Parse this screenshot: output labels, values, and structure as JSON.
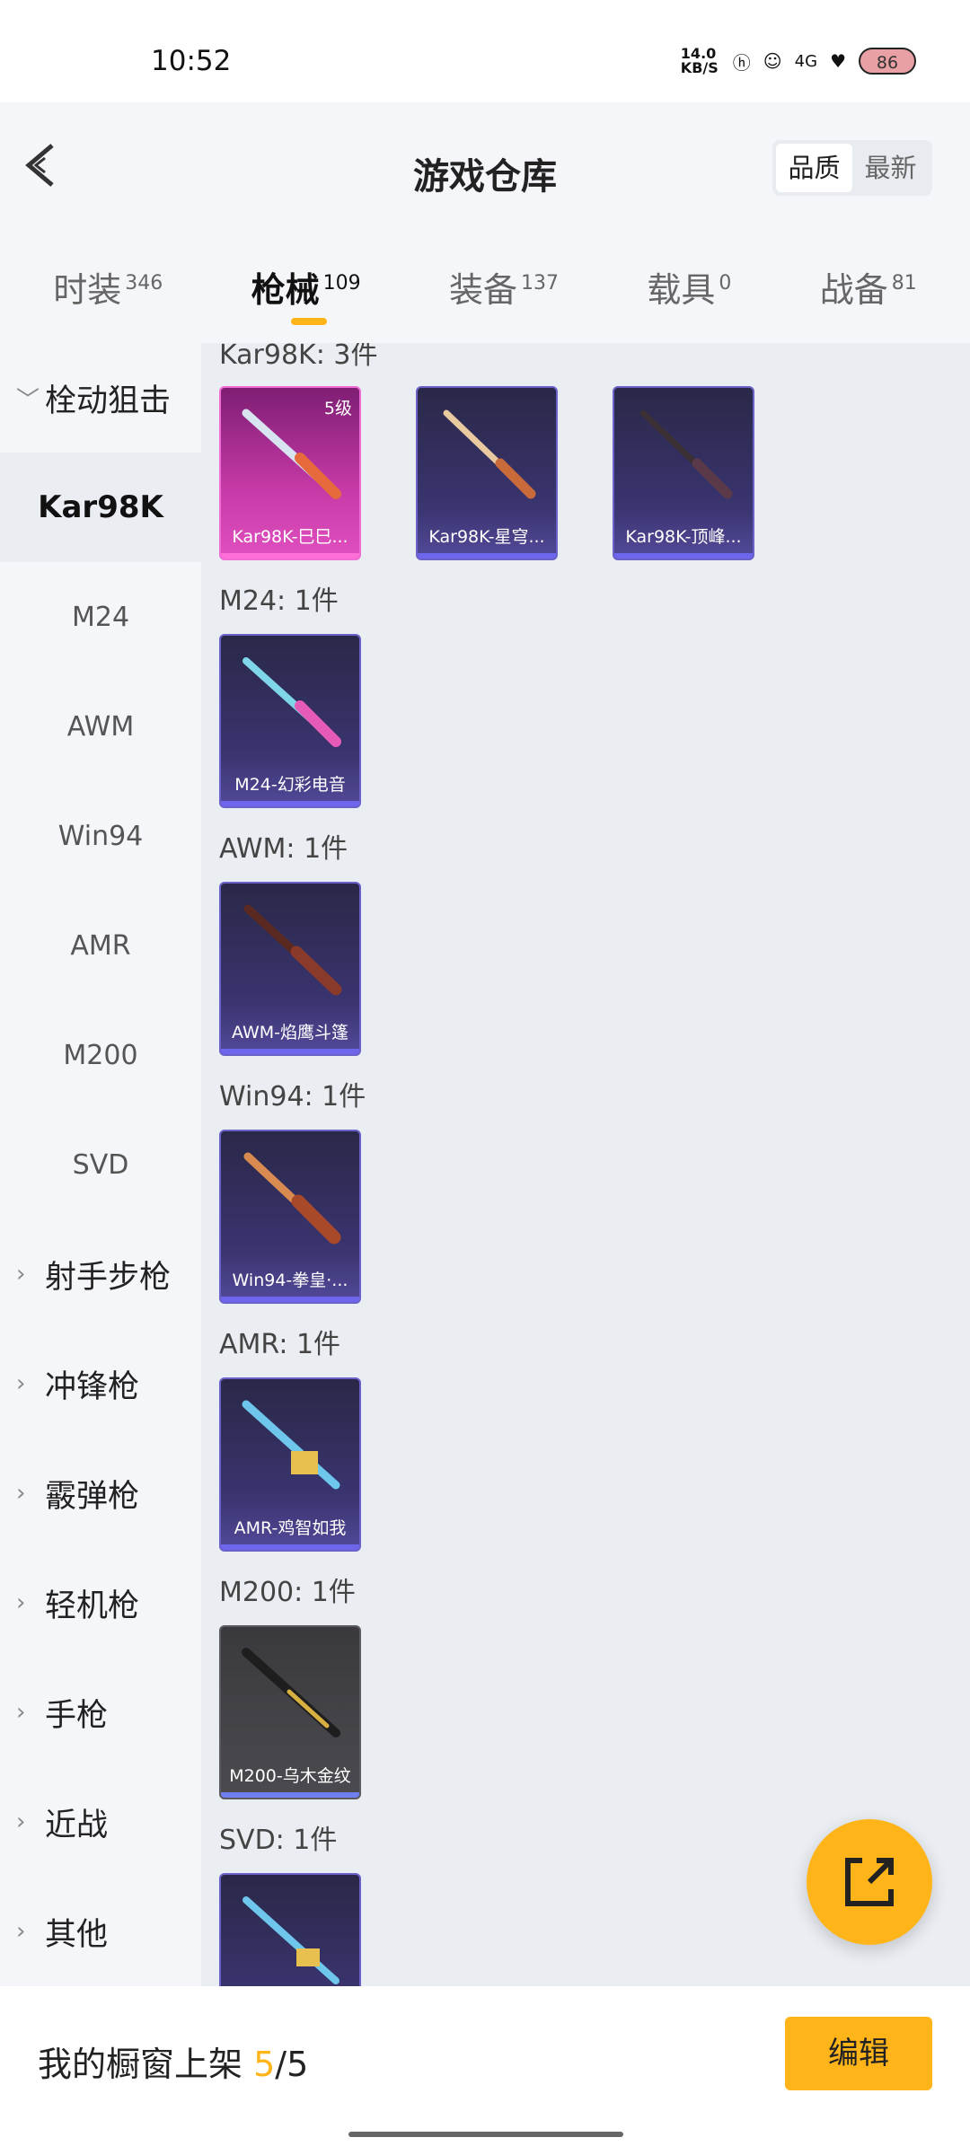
{
  "status_bar": {
    "time": "10:52",
    "net_speed": "14.0 KB/S",
    "network": "4G",
    "battery": "86"
  },
  "header": {
    "title": "游戏仓库",
    "sort_options": [
      "品质",
      "最新"
    ],
    "active_sort": "品质"
  },
  "tabs": [
    {
      "label": "时装",
      "count": "346"
    },
    {
      "label": "枪械",
      "count": "109"
    },
    {
      "label": "装备",
      "count": "137"
    },
    {
      "label": "载具",
      "count": "0"
    },
    {
      "label": "战备",
      "count": "81"
    }
  ],
  "sidebar": {
    "expanded_category": "栓动狙击",
    "sub_items": [
      "Kar98K",
      "M24",
      "AWM",
      "Win94",
      "AMR",
      "M200",
      "SVD"
    ],
    "active_sub": "Kar98K",
    "categories": [
      "射手步枪",
      "冲锋枪",
      "霰弹枪",
      "轻机枪",
      "手枪",
      "近战",
      "其他"
    ]
  },
  "groups": [
    {
      "title": "Kar98K: 3件",
      "items": [
        {
          "name": "Kar98K-巳巳...",
          "level": "5级",
          "style": "pink"
        },
        {
          "name": "Kar98K-星穹...",
          "style": "purple"
        },
        {
          "name": "Kar98K-顶峰...",
          "style": "purple"
        }
      ]
    },
    {
      "title": "M24: 1件",
      "items": [
        {
          "name": "M24-幻彩电音",
          "style": "purple"
        }
      ]
    },
    {
      "title": "AWM: 1件",
      "items": [
        {
          "name": "AWM-焰鹰斗篷",
          "style": "purple"
        }
      ]
    },
    {
      "title": "Win94: 1件",
      "items": [
        {
          "name": "Win94-拳皇·...",
          "style": "purple"
        }
      ]
    },
    {
      "title": "AMR: 1件",
      "items": [
        {
          "name": "AMR-鸡智如我",
          "style": "purple"
        }
      ]
    },
    {
      "title": "M200: 1件",
      "items": [
        {
          "name": "M200-乌木金纹",
          "style": "grey"
        }
      ]
    },
    {
      "title": "SVD: 1件",
      "items": [
        {
          "name": "",
          "style": "purple"
        }
      ]
    }
  ],
  "bottom_bar": {
    "label": "我的橱窗上架",
    "current": "5",
    "total": "/5",
    "edit_label": "编辑"
  },
  "colors": {
    "accent": "#ffb51a"
  }
}
